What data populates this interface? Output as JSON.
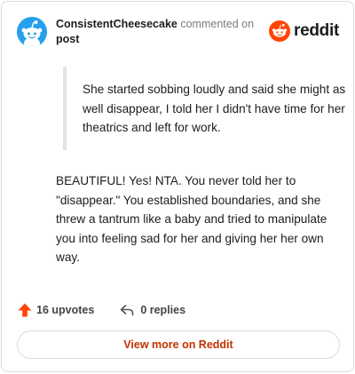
{
  "header": {
    "username": "ConsistentCheesecake",
    "action": "commented on",
    "post_link": "post",
    "logo_text": "reddit"
  },
  "comment": {
    "quote": "She started sobbing loudly and said she might as well disappear, I told her I didn't have time for her theatrics and left for work.",
    "body": "BEAUTIFUL! Yes! NTA. You never told her to \"disappear.\" You established boundaries, and she threw a tantrum like a baby and tried to manipulate you into feeling sad for her and giving her her own way."
  },
  "actions": {
    "upvotes": "16 upvotes",
    "replies": "0 replies"
  },
  "footer": {
    "view_more": "View more on Reddit"
  },
  "colors": {
    "accent": "#ff4500",
    "avatar": "#24a0ed",
    "link_text": "#c33200"
  },
  "icons": {
    "avatar": "snoo-avatar-icon",
    "logo": "reddit-logo-icon",
    "upvote": "upvote-arrow-icon",
    "reply": "reply-arrow-icon"
  }
}
